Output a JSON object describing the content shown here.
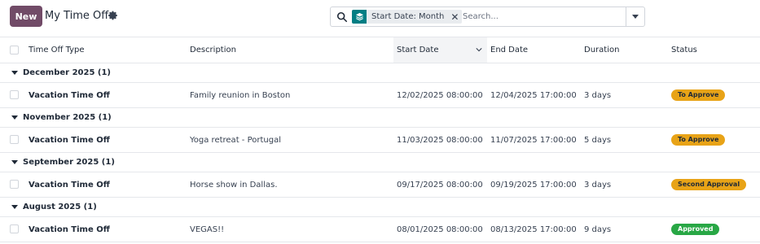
{
  "toolbar": {
    "new_label": "New",
    "title": "My Time Off",
    "settings_icon": "gear-icon"
  },
  "search": {
    "facet_label": "Start Date: Month",
    "facet_icon": "layers-icon",
    "placeholder": "Search...",
    "value": ""
  },
  "columns": {
    "type": "Time Off Type",
    "description": "Description",
    "start": "Start Date",
    "end": "End Date",
    "duration": "Duration",
    "status": "Status"
  },
  "groups": [
    {
      "label": "December 2025 (1)",
      "row": {
        "type": "Vacation Time Off",
        "description": "Family reunion in Boston",
        "start": "12/02/2025 08:00:00",
        "end": "12/04/2025 17:00:00",
        "duration": "3 days",
        "status": "To Approve"
      }
    },
    {
      "label": "November 2025 (1)",
      "row": {
        "type": "Vacation Time Off",
        "description": "Yoga retreat - Portugal",
        "start": "11/03/2025 08:00:00",
        "end": "11/07/2025 17:00:00",
        "duration": "5 days",
        "status": "To Approve"
      }
    },
    {
      "label": "September 2025 (1)",
      "row": {
        "type": "Vacation Time Off",
        "description": "Horse show in Dallas.",
        "start": "09/17/2025 08:00:00",
        "end": "09/19/2025 17:00:00",
        "duration": "3 days",
        "status": "Second Approval"
      }
    },
    {
      "label": "August 2025 (1)",
      "row": {
        "type": "Vacation Time Off",
        "description": "VEGAS!!",
        "start": "08/01/2025 08:00:00",
        "end": "08/13/2025 17:00:00",
        "duration": "9 days",
        "status": "Approved"
      }
    }
  ],
  "colors": {
    "brand": "#714B67",
    "facet": "#017e84",
    "warning": "#e8a317",
    "success": "#28a745"
  }
}
